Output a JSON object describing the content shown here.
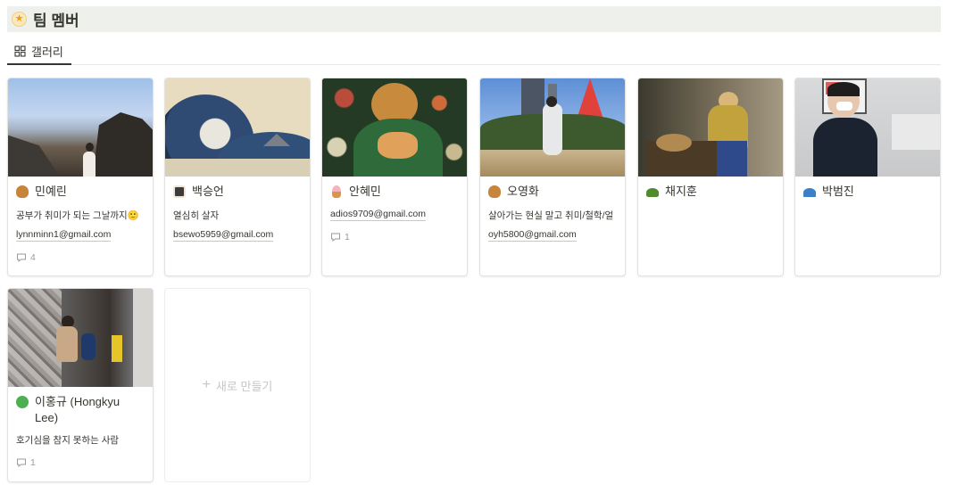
{
  "page": {
    "title": "팀 멤버",
    "icon": "star-emoji-icon"
  },
  "tabs": [
    {
      "label": "갤러리",
      "icon": "gallery-grid-icon"
    }
  ],
  "cards": [
    {
      "name": "민예린",
      "icon": "squirrel-icon",
      "text": "공부가 취미가 되는 그날까지🙂",
      "email": "lynnminn1@gmail.com",
      "comments": "4"
    },
    {
      "name": "백승언",
      "icon": "avatar-icon",
      "text": "열심히 살자",
      "email": "bsewo5959@gmail.com",
      "comments": ""
    },
    {
      "name": "안혜민",
      "icon": "ice-cream-icon",
      "text": "",
      "email": "adios9709@gmail.com",
      "comments": "1"
    },
    {
      "name": "오영화",
      "icon": "squirrel-icon",
      "text": "살아가는 현실 말고 취미/철학/얼",
      "email": "oyh5800@gmail.com",
      "comments": ""
    },
    {
      "name": "채지훈",
      "icon": "turtle-icon",
      "text": "",
      "email": "",
      "comments": ""
    },
    {
      "name": "박범진",
      "icon": "blue-cap-icon",
      "text": "",
      "email": "",
      "comments": ""
    },
    {
      "name": "이홍규 (Hongkyu Lee)",
      "icon": "clover-icon",
      "text": "호기심을 참지 못하는 사람",
      "email": "",
      "comments": "1"
    }
  ],
  "new_card": {
    "label": "새로 만들기"
  }
}
